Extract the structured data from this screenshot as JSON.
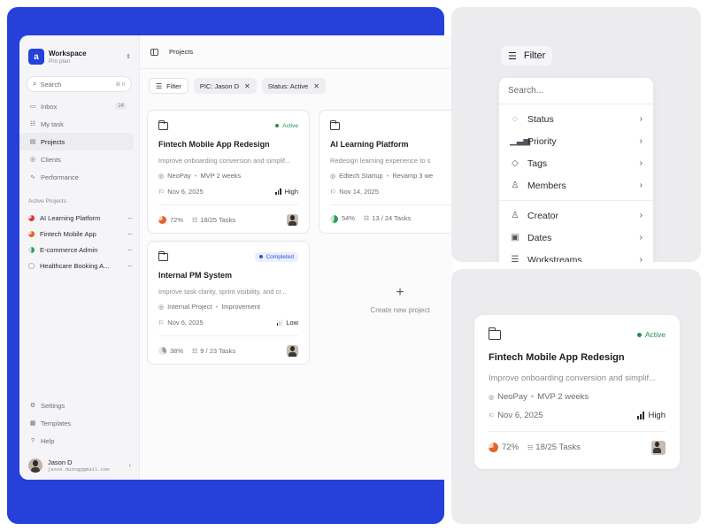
{
  "workspace": {
    "name": "Workspace",
    "plan": "Pro plan",
    "logo": "a"
  },
  "search": {
    "label": "Search",
    "shortcut": "⌘ K"
  },
  "nav": [
    {
      "label": "Inbox",
      "icon": "inbox-icon",
      "badge": "24"
    },
    {
      "label": "My task",
      "icon": "task-icon",
      "badge": ""
    },
    {
      "label": "Projects",
      "icon": "folder-icon",
      "badge": ""
    },
    {
      "label": "Clients",
      "icon": "clients-icon",
      "badge": ""
    },
    {
      "label": "Performance",
      "icon": "performance-icon",
      "badge": ""
    }
  ],
  "active_projects": {
    "title": "Active Projects",
    "items": [
      {
        "label": "AI Learning Platform",
        "color": "#d9362b"
      },
      {
        "label": "Fintech Mobile App",
        "color": "#e0642f"
      },
      {
        "label": "E-commerce Admin",
        "color": "#2e9e5a"
      },
      {
        "label": "Healthcare Booking A...",
        "color": "#c7c7cf"
      }
    ]
  },
  "bottom_nav": [
    {
      "label": "Settings"
    },
    {
      "label": "Templates"
    },
    {
      "label": "Help"
    }
  ],
  "user": {
    "name": "Jason D",
    "email": "jason.duong@gmail.com"
  },
  "topbar": {
    "title": "Projects"
  },
  "filters": {
    "filter_label": "Filter",
    "chips": [
      "PIC: Jason D",
      "Status: Active"
    ]
  },
  "cards": [
    {
      "status": "Active",
      "title": "Fintech Mobile App Redesign",
      "desc": "Improve onboarding conversion and simplif...",
      "client": "NeoPay",
      "phase": "MVP 2 weeks",
      "date": "Nov 6, 2025",
      "priority": "High",
      "progress": "72%",
      "tasks": "18/25 Tasks"
    },
    {
      "status": "",
      "title": "AI Learning Platform",
      "desc": "Redesign learning experience to s",
      "client": "Edtech Startup",
      "phase": "Revamp 3 we",
      "date": "Nov 14, 2025",
      "priority": "",
      "progress": "54%",
      "tasks": "13 / 24 Tasks"
    },
    {
      "status": "Completed",
      "title": "Internal PM System",
      "desc": "Improve task clarity, sprint visibility, and cr...",
      "client": "Internal Project",
      "phase": "Improvement",
      "date": "Nov 6, 2025",
      "priority": "Low",
      "progress": "38%",
      "tasks": "9 / 23 Tasks"
    }
  ],
  "create": {
    "label": "Create new project"
  },
  "filter_panel": {
    "button": "Filter",
    "search_placeholder": "Search...",
    "items_a": [
      {
        "label": "Status",
        "icon": "status-icon"
      },
      {
        "label": "Priority",
        "icon": "priority-icon"
      },
      {
        "label": "Tags",
        "icon": "tag-icon"
      },
      {
        "label": "Members",
        "icon": "members-icon"
      }
    ],
    "items_b": [
      {
        "label": "Creator",
        "icon": "creator-icon"
      },
      {
        "label": "Dates",
        "icon": "calendar-icon"
      },
      {
        "label": "Workstreams",
        "icon": "workstreams-icon"
      }
    ]
  },
  "colors": {
    "brand": "#2541d9",
    "active": "#1f8f4e",
    "completed": "#3152d8"
  }
}
